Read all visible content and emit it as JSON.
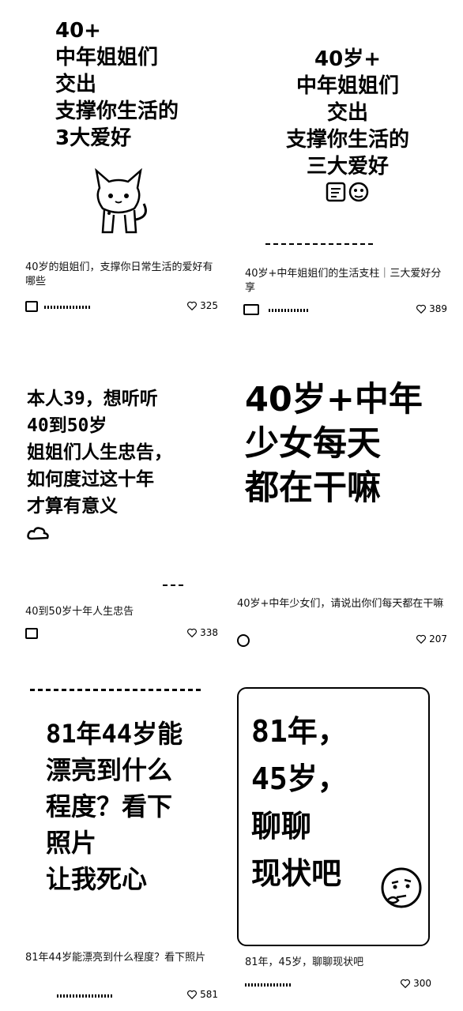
{
  "posts": [
    {
      "cover_text": "40+\n中年姐姐们\n交出\n支撑你生活的\n3大爱好",
      "caption": "40岁的姐姐们，支撑你日常生活的爱好有哪些",
      "likes": "325",
      "cover_icon": "cat-illustration"
    },
    {
      "cover_text": "40岁+\n中年姐姐们\n交出\n支撑你生活的\n三大爱好",
      "caption": "40岁+中年姐姐们的生活支柱｜三大爱好分享",
      "likes": "389",
      "cover_icon": "emoji-doodles"
    },
    {
      "cover_text": "本人39，想听听\n40到50岁\n姐姐们人生忠告，\n如何度过这十年\n才算有意义",
      "caption": "40到50岁十年人生忠告",
      "likes": "338",
      "cover_icon": "cloud-icon"
    },
    {
      "cover_text": "40岁+中年\n少女每天\n都在干嘛",
      "caption": "40岁+中年少女们，请说出你们每天都在干嘛",
      "likes": "207",
      "cover_icon": ""
    },
    {
      "cover_text": "81年44岁能\n漂亮到什么\n程度？看下\n照片\n让我死心",
      "caption": "81年44岁能漂亮到什么程度？看下照片",
      "likes": "581",
      "cover_icon": ""
    },
    {
      "cover_text": "81年，\n45岁，\n聊聊\n现状吧",
      "caption": "81年，45岁，聊聊现状吧",
      "likes": "300",
      "cover_icon": "thinking-face-emoji"
    }
  ]
}
